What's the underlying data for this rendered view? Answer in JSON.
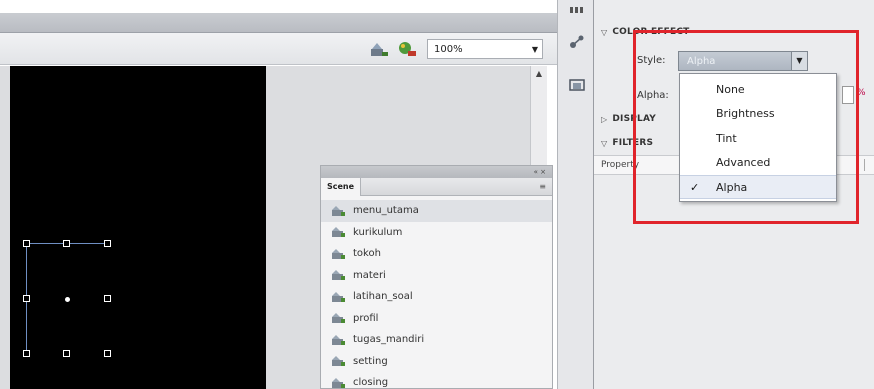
{
  "stage": {
    "zoom_value": "100%"
  },
  "scene_panel": {
    "tab_label": "Scene",
    "top_controls": "« ×",
    "menu_icon": "≡",
    "items": [
      {
        "label": "menu_utama",
        "selected": true
      },
      {
        "label": "kurikulum",
        "selected": false
      },
      {
        "label": "tokoh",
        "selected": false
      },
      {
        "label": "materi",
        "selected": false
      },
      {
        "label": "latihan_soal",
        "selected": false
      },
      {
        "label": "profil",
        "selected": false
      },
      {
        "label": "tugas_mandiri",
        "selected": false
      },
      {
        "label": "setting",
        "selected": false
      },
      {
        "label": "closing",
        "selected": false
      }
    ]
  },
  "properties": {
    "color_effect_header": "COLOR EFFECT",
    "style_label": "Style:",
    "style_value": "Alpha",
    "alpha_label": "Alpha:",
    "alpha_unit": "%",
    "display_header": "DISPLAY",
    "filters_header": "FILTERS",
    "property_column": "Property"
  },
  "style_dropdown": {
    "options": [
      {
        "label": "None",
        "checked": false
      },
      {
        "label": "Brightness",
        "checked": false
      },
      {
        "label": "Tint",
        "checked": false
      },
      {
        "label": "Advanced",
        "checked": false
      },
      {
        "label": "Alpha",
        "checked": true
      }
    ],
    "check_mark": "✓"
  },
  "colors": {
    "highlight": "#e0242b",
    "stage": "#000000",
    "select_fill": "#b4bcc7"
  }
}
